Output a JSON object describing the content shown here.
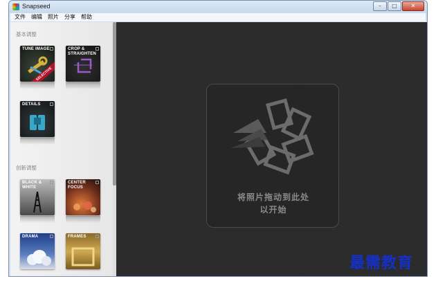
{
  "window": {
    "title": "Snapseed"
  },
  "menu": [
    "文件",
    "编辑",
    "照片",
    "分享",
    "帮助"
  ],
  "sections": {
    "basic": "基本调整",
    "creative": "创新调整"
  },
  "tools": {
    "tune_image": "TUNE IMAGE",
    "selective": "SELECTIVE",
    "crop_straighten": "CROP & STRAIGHTEN",
    "details": "DETAILS",
    "black_white": "BLACK & WHITE",
    "center_focus": "CENTER FOCUS",
    "drama": "DRAMA",
    "frames": "FRAMES"
  },
  "drop_zone": {
    "line1": "将照片拖动到此处",
    "line2": "以开始"
  },
  "watermark": "最需教育"
}
